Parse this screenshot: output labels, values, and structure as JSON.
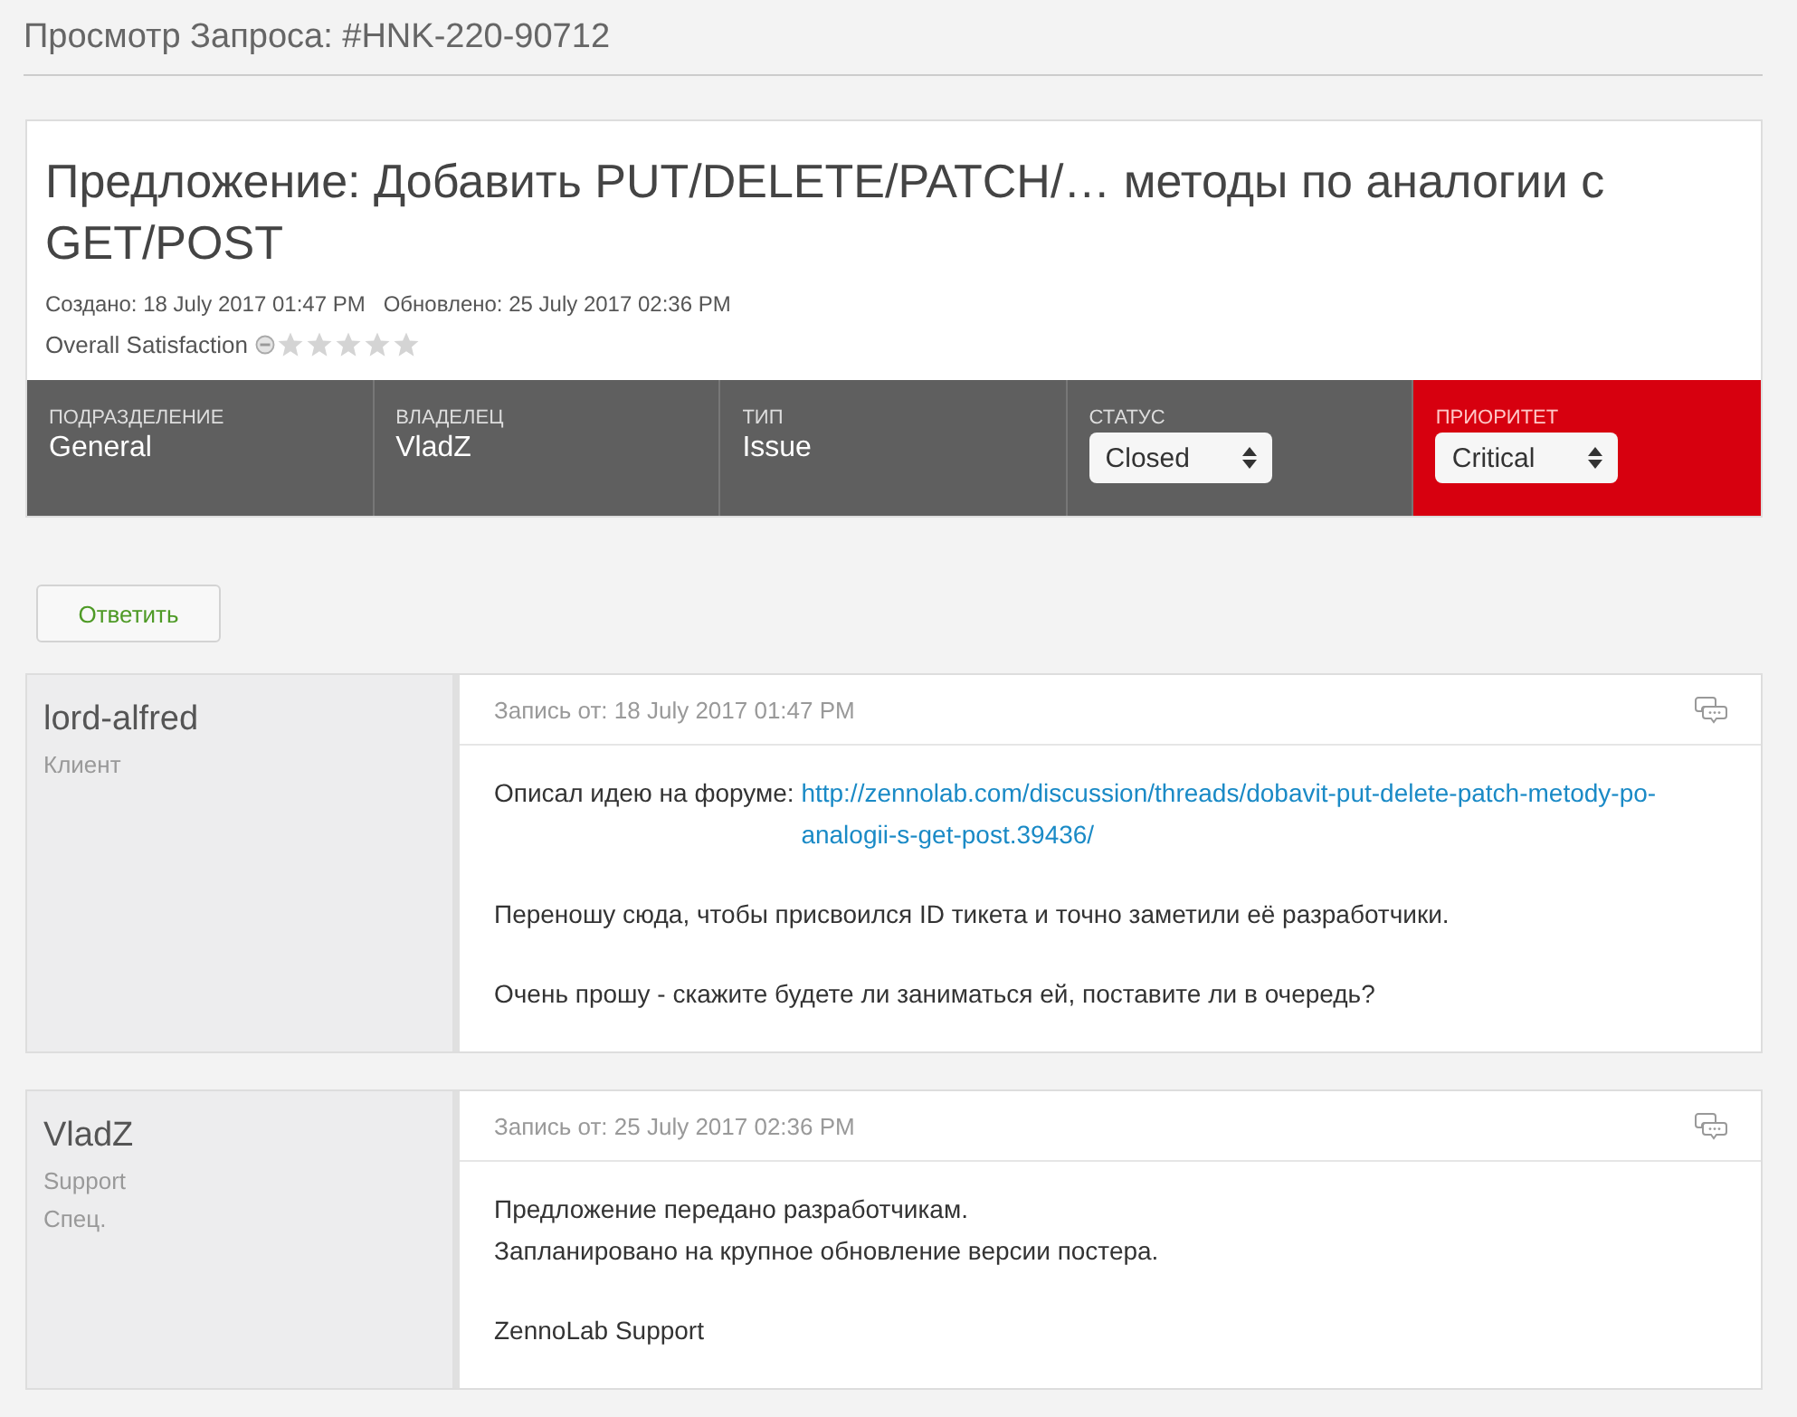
{
  "page_title": "Просмотр Запроса: #HNK-220-90712",
  "ticket": {
    "subject": "Предложение: Добавить PUT/DELETE/PATCH/… методы по аналогии с GET/POST",
    "created": "Создано: 18 July 2017 01:47 PM",
    "updated": "Обновлено: 25 July 2017 02:36 PM",
    "satisfaction_label": "Overall Satisfaction",
    "stars": 0
  },
  "fields": [
    {
      "kind": "text",
      "label": "ПОДРАЗДЕЛЕНИЕ",
      "value": "General",
      "highlight": false
    },
    {
      "kind": "text",
      "label": "ВЛАДЕЛЕЦ",
      "value": "VladZ",
      "highlight": false
    },
    {
      "kind": "text",
      "label": "ТИП",
      "value": "Issue",
      "highlight": false
    },
    {
      "kind": "select",
      "label": "СТАТУС",
      "value": "Closed",
      "highlight": false
    },
    {
      "kind": "select",
      "label": "ПРИОРИТЕТ",
      "value": "Critical",
      "highlight": true,
      "color": "#d7000f"
    }
  ],
  "reply_button": "Ответить",
  "posts": [
    {
      "author": "lord-alfred",
      "roles": [
        "Клиент"
      ],
      "date": "Запись от: 18 July 2017 01:47 PM",
      "paragraphs": [
        [
          {
            "text": "Описал идею на форуме: ",
            "link": "http://zennolab.com/discussion/threads/dobavit-put-delete-patch-metody-po-analogii-s-get-post.39436/"
          }
        ],
        [
          {
            "text": "Переношу сюда, чтобы присвоился ID тикета и точно заметили её разработчики."
          }
        ],
        [
          {
            "text": "Очень прошу - скажите будете ли заниматься ей, поставите ли в очередь?"
          }
        ]
      ]
    },
    {
      "author": "VladZ",
      "roles": [
        "Support",
        "Спец."
      ],
      "date": "Запись от: 25 July 2017 02:36 PM",
      "paragraphs": [
        [
          {
            "text": "Предложение передано разработчикам."
          },
          {
            "text": "Запланировано на крупное обновление версии постера."
          }
        ],
        [
          {
            "text": "ZennoLab Support"
          }
        ]
      ]
    }
  ]
}
